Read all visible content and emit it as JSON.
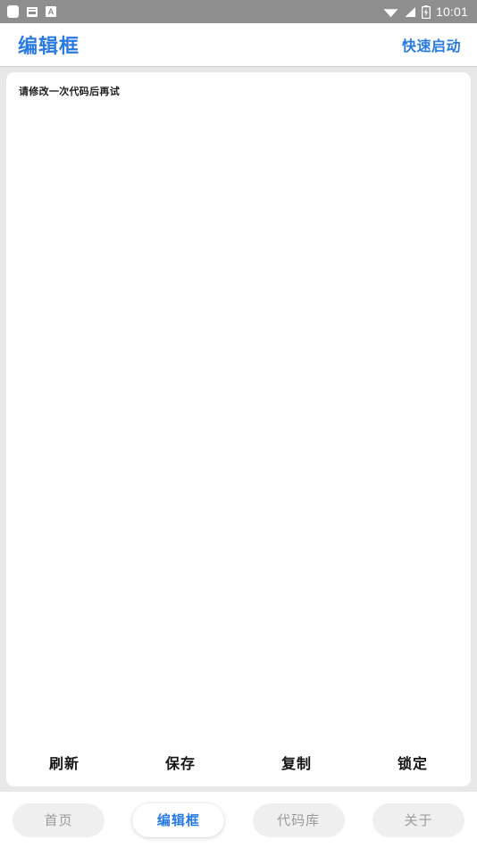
{
  "statusbar": {
    "icons_left": [
      "app-square-icon",
      "sim-card-icon",
      "font-a-icon"
    ],
    "icons_right": [
      "wifi-icon",
      "signal-icon",
      "battery-charging-icon"
    ],
    "time": "10:01"
  },
  "header": {
    "title": "编辑框",
    "action_label": "快速启动"
  },
  "editor": {
    "content": "请修改一次代码后再试"
  },
  "actions": [
    {
      "label": "刷新",
      "name": "refresh"
    },
    {
      "label": "保存",
      "name": "save"
    },
    {
      "label": "复制",
      "name": "copy"
    },
    {
      "label": "锁定",
      "name": "lock"
    }
  ],
  "tabs": [
    {
      "label": "首页",
      "name": "home",
      "active": false
    },
    {
      "label": "编辑框",
      "name": "editor",
      "active": true
    },
    {
      "label": "代码库",
      "name": "code-library",
      "active": false
    },
    {
      "label": "关于",
      "name": "about",
      "active": false
    }
  ],
  "colors": {
    "accent": "#2a7ae4",
    "statusbar_bg": "#8e8e8e",
    "page_bg": "#e8e8e8",
    "card_bg": "#ffffff",
    "tab_inactive_bg": "#efefef",
    "tab_inactive_text": "#9b9b9b"
  }
}
